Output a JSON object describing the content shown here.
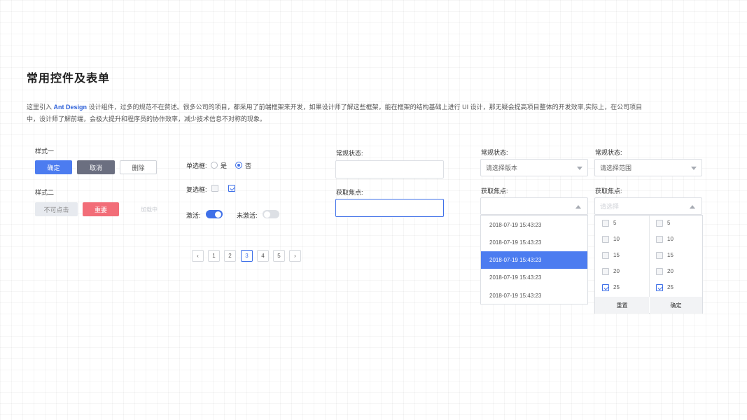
{
  "page": {
    "title": "常用控件及表单",
    "desc_prefix": "这里引入",
    "desc_brand": "Ant Design",
    "desc_rest": "设计组件，过多的规范不在赘述。很多公司的项目，都采用了前端框架来开发，如果设计师了解这些框架，能在框架的结构基础上进行 UI 设计，那无疑会提高项目整体的开发效率,实际上，在公司项目中，设计师了解前端，会极大提升和程序员的协作效率，减少技术信息不对称的现象。"
  },
  "buttons": {
    "style1_label": "样式一",
    "confirm": "确定",
    "cancel": "取消",
    "delete": "删除",
    "style2_label": "样式二",
    "disabled": "不可点击",
    "important": "重要",
    "ghost": "加载中"
  },
  "controls": {
    "radio_label": "单选框:",
    "radio_yes": "是",
    "radio_no": "否",
    "checkbox_label": "复选框:",
    "switch_on_label": "激活:",
    "switch_off_label": "未激活:"
  },
  "pagination": {
    "prev": "‹",
    "pages": [
      "1",
      "2",
      "3",
      "4",
      "5"
    ],
    "current": "3",
    "next": "›"
  },
  "inputs": {
    "normal_label": "常规状态:",
    "focus_label": "获取焦点:"
  },
  "select1": {
    "normal_label": "常规状态:",
    "placeholder": "请选择版本",
    "focus_label": "获取焦点:",
    "options": [
      "2018-07-19   15:43:23",
      "2018-07-19   15:43:23",
      "2018-07-19   15:43:23",
      "2018-07-19   15:43:23",
      "2018-07-19   15:43:23"
    ],
    "selected_index": 2
  },
  "select2": {
    "normal_label": "常规状态:",
    "placeholder": "请选择范围",
    "focus_label": "获取焦点:",
    "focus_placeholder": "请选择",
    "left_options": [
      "5",
      "10",
      "15",
      "20",
      "25"
    ],
    "right_options": [
      "5",
      "10",
      "15",
      "20",
      "25"
    ],
    "checked": [
      "25"
    ],
    "reset": "重置",
    "confirm": "确定"
  },
  "colors": {
    "primary": "#4c7cf0",
    "danger": "#f26d78",
    "dark": "#6b6f80"
  }
}
